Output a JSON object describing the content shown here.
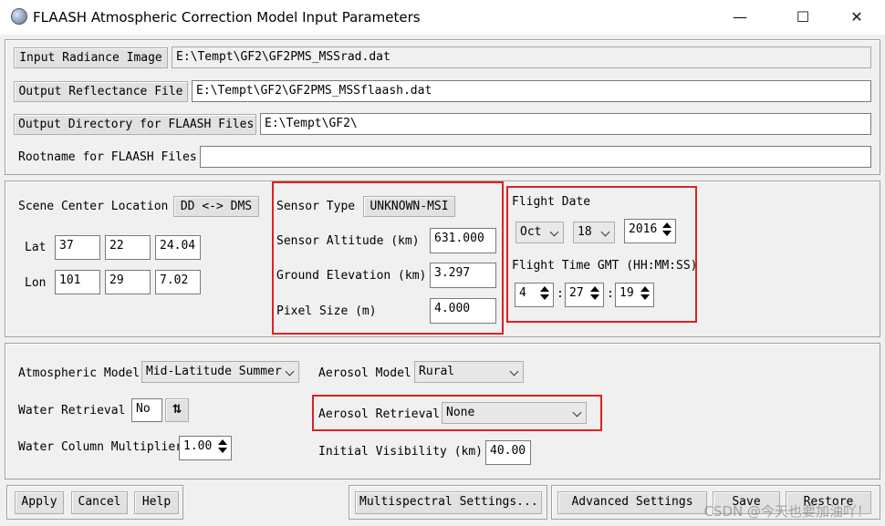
{
  "window": {
    "title": "FLAASH Atmospheric Correction Model Input Parameters",
    "minimize": "—",
    "maximize": "☐",
    "close": "✕"
  },
  "files": {
    "input_radiance_label": "Input Radiance Image",
    "input_radiance_value": "E:\\Tempt\\GF2\\GF2PMS_MSSrad.dat",
    "output_reflectance_label": "Output Reflectance File",
    "output_reflectance_value": "E:\\Tempt\\GF2\\GF2PMS_MSSflaash.dat",
    "output_directory_label": "Output Directory for FLAASH Files",
    "output_directory_value": "E:\\Tempt\\GF2\\",
    "rootname_label": "Rootname for FLAASH Files",
    "rootname_value": ""
  },
  "scene": {
    "center_label": "Scene Center Location",
    "dd_dms_button": "DD <-> DMS",
    "lat_label": "Lat",
    "lat": [
      "37",
      "22",
      "24.04"
    ],
    "lon_label": "Lon",
    "lon": [
      "101",
      "29",
      "7.02"
    ]
  },
  "sensor": {
    "type_label": "Sensor Type",
    "type_value": "UNKNOWN-MSI",
    "altitude_label": "Sensor Altitude (km)",
    "altitude_value": "631.000",
    "ground_label": "Ground Elevation (km)",
    "ground_value": "3.297",
    "pixel_label": "Pixel Size (m)",
    "pixel_value": "4.000"
  },
  "flight": {
    "date_label": "Flight Date",
    "month": "Oct",
    "day": "18",
    "year": "2016",
    "time_label": "Flight Time GMT (HH:MM:SS)",
    "hh": "4",
    "mm": "27",
    "ss": "19",
    "sep": ":"
  },
  "atmosphere": {
    "model_label": "Atmospheric Model",
    "model_value": "Mid-Latitude Summer",
    "water_label": "Water Retrieval",
    "water_value": "No",
    "water_toggle": "⇅",
    "multiplier_label": "Water Column Multiplier",
    "multiplier_value": "1.00",
    "aerosol_model_label": "Aerosol Model",
    "aerosol_model_value": "Rural",
    "aerosol_retrieval_label": "Aerosol Retrieval",
    "aerosol_retrieval_value": "None",
    "visibility_label": "Initial Visibility (km)",
    "visibility_value": "40.00"
  },
  "footer": {
    "apply": "Apply",
    "cancel": "Cancel",
    "help": "Help",
    "multispectral": "Multispectral Settings...",
    "advanced": "Advanced Settings",
    "save": "Save",
    "restore": "Restore",
    "watermark": "CSDN @今天也要加油吖！"
  },
  "colors": {
    "highlight": "#e02020",
    "background": "#f0f0f0"
  }
}
